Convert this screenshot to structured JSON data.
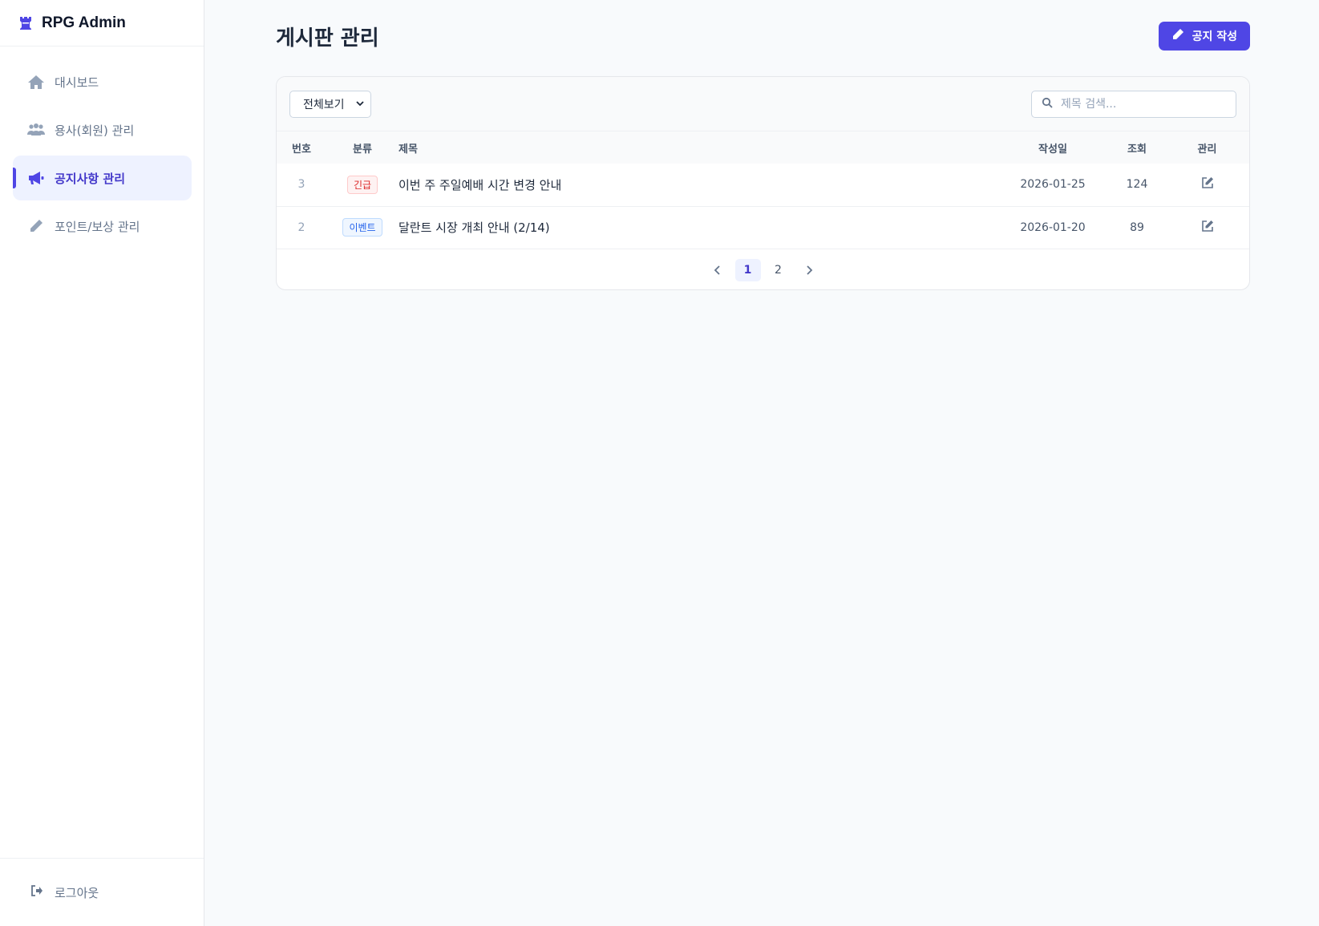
{
  "brand": {
    "name": "RPG Admin",
    "icon": "rook-icon"
  },
  "sidebar": {
    "items": [
      {
        "label": "대시보드",
        "icon": "home-icon",
        "active": false
      },
      {
        "label": "용사(회원) 관리",
        "icon": "users-icon",
        "active": false
      },
      {
        "label": "공지사항 관리",
        "icon": "megaphone-icon",
        "active": true
      },
      {
        "label": "포인트/보상 관리",
        "icon": "pencil-icon",
        "active": false
      }
    ],
    "logout_label": "로그아웃"
  },
  "header": {
    "title": "게시판 관리",
    "write_button": "공지 작성"
  },
  "filter": {
    "selected": "전체보기"
  },
  "search": {
    "placeholder": "제목 검색..."
  },
  "table": {
    "columns": [
      "번호",
      "분류",
      "제목",
      "작성일",
      "조회",
      "관리"
    ],
    "rows": [
      {
        "no": "3",
        "category": "긴급",
        "title": "이번 주 주일예배 시간 변경 안내",
        "date": "2026-01-25",
        "views": "124"
      },
      {
        "no": "2",
        "category": "이벤트",
        "title": "달란트 시장 개최 안내 (2/14)",
        "date": "2026-01-20",
        "views": "89"
      }
    ]
  },
  "pagination": {
    "pages": [
      "1",
      "2"
    ],
    "current": "1"
  },
  "colors": {
    "accent": "#4f46e5",
    "urgent_text": "#dc2626",
    "urgent_bg": "#fef2f2",
    "urgent_border": "#fecaca",
    "event_text": "#2563eb",
    "event_bg": "#eff6ff",
    "event_border": "#bfdbfe"
  }
}
